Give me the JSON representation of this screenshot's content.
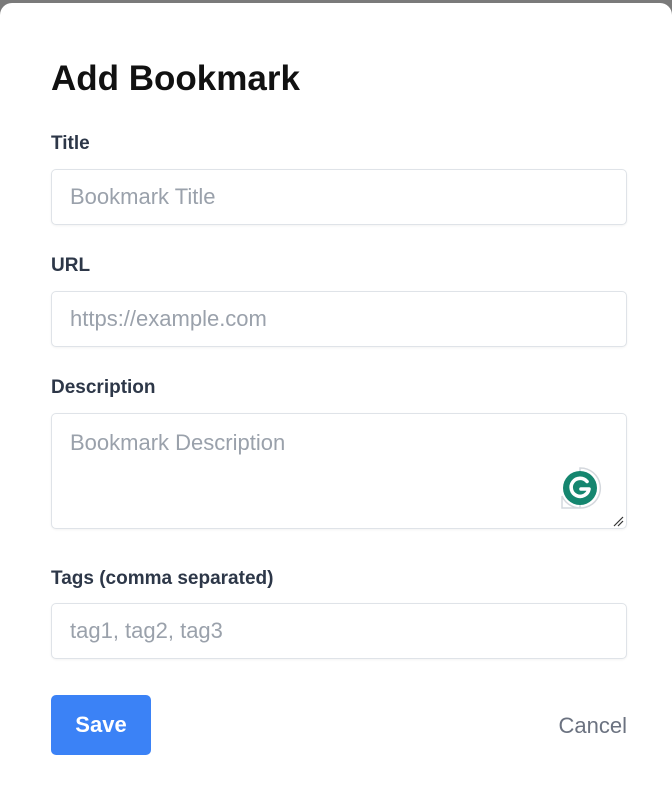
{
  "dialog": {
    "title": "Add Bookmark"
  },
  "form": {
    "title_label": "Title",
    "title_placeholder": "Bookmark Title",
    "url_label": "URL",
    "url_placeholder": "https://example.com",
    "description_label": "Description",
    "description_placeholder": "Bookmark Description",
    "tags_label": "Tags (comma separated)",
    "tags_placeholder": "tag1, tag2, tag3"
  },
  "actions": {
    "save_label": "Save",
    "cancel_label": "Cancel"
  },
  "icons": {
    "grammarly": "grammarly-icon",
    "resize": "resize-handle-icon"
  },
  "colors": {
    "primary": "#3b82f6",
    "grammarly": "#15866f"
  }
}
